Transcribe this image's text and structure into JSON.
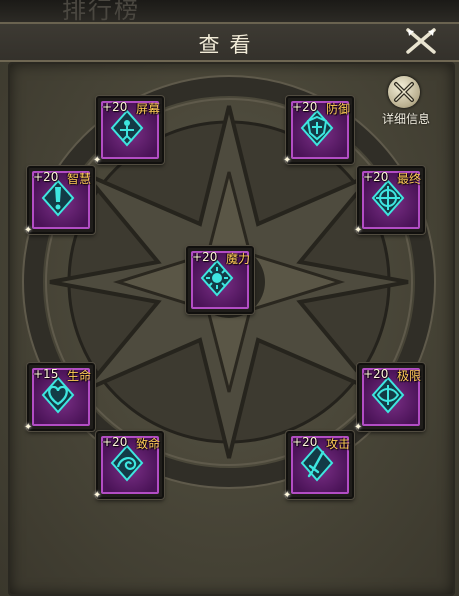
{
  "window": {
    "title": "查看"
  },
  "partial_header_text": "排行榜",
  "detail_button": {
    "label": "详细信息"
  },
  "slots": [
    {
      "id": "pingzhang",
      "level": "+20",
      "name": "屏幕"
    },
    {
      "id": "fangyu",
      "level": "+20",
      "name": "防御"
    },
    {
      "id": "zhihui",
      "level": "+20",
      "name": "智慧"
    },
    {
      "id": "zuizhong",
      "level": "+20",
      "name": "最终"
    },
    {
      "id": "moli",
      "level": "+20",
      "name": "魔力"
    },
    {
      "id": "shengming",
      "level": "+15",
      "name": "生命"
    },
    {
      "id": "jixian",
      "level": "+20",
      "name": "极限"
    },
    {
      "id": "zhiming",
      "level": "+20",
      "name": "致命"
    },
    {
      "id": "gongji",
      "level": "+20",
      "name": "攻击"
    }
  ],
  "colors": {
    "slot_border": "#b24dc4",
    "slot_fill": "#5a1a68",
    "rune_icon": "#3ee6e0",
    "level_text": "#fff6d9",
    "name_text": "#ffcc55"
  },
  "icons": {
    "close": "crossed-swords-close-icon",
    "detail": "crossed-swords-icon"
  }
}
